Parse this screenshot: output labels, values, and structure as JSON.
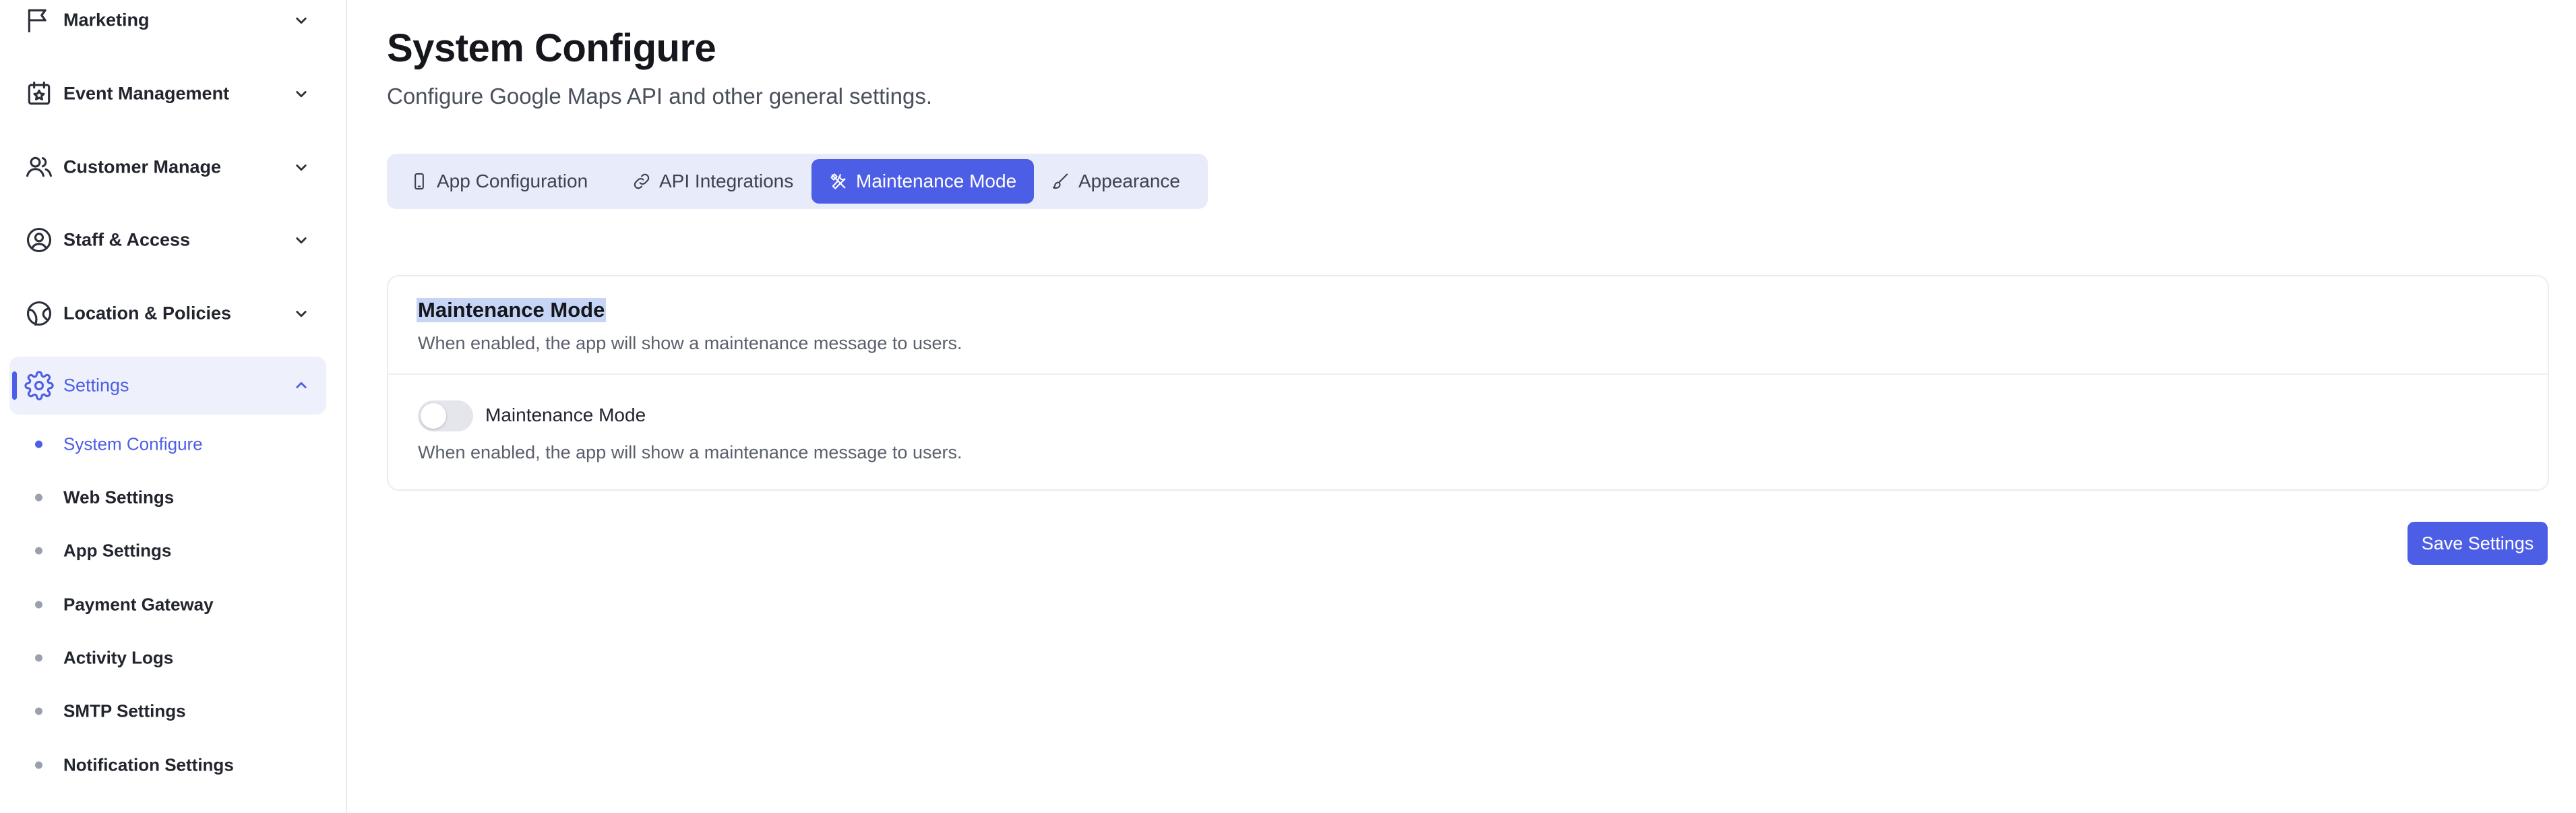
{
  "sidebar": {
    "nav": [
      {
        "label": "Marketing",
        "icon": "megaphone-icon"
      },
      {
        "label": "Event Management",
        "icon": "calendar-star-icon"
      },
      {
        "label": "Customer Manage",
        "icon": "users-icon"
      },
      {
        "label": "Staff & Access",
        "icon": "user-circle-icon"
      },
      {
        "label": "Location & Policies",
        "icon": "globe-icon"
      },
      {
        "label": "Settings",
        "icon": "gear-icon",
        "expanded": true
      }
    ],
    "settings_children": [
      {
        "label": "System Configure",
        "active": true
      },
      {
        "label": "Web Settings"
      },
      {
        "label": "App Settings"
      },
      {
        "label": "Payment Gateway"
      },
      {
        "label": "Activity Logs"
      },
      {
        "label": "SMTP Settings"
      },
      {
        "label": "Notification Settings"
      }
    ]
  },
  "header": {
    "title": "System Configure",
    "subtitle": "Configure Google Maps API and other general settings."
  },
  "tabs": [
    {
      "label": "App Configuration",
      "icon": "smartphone-icon"
    },
    {
      "label": "API Integrations",
      "icon": "link-icon"
    },
    {
      "label": "Maintenance Mode",
      "icon": "tools-icon",
      "active": true
    },
    {
      "label": "Appearance",
      "icon": "brush-icon"
    }
  ],
  "card": {
    "title": "Maintenance Mode",
    "description": "When enabled, the app will show a maintenance message to users.",
    "toggle_label": "Maintenance Mode",
    "toggle_description": "When enabled, the app will show a maintenance message to users.",
    "toggle_on": false
  },
  "actions": {
    "save_label": "Save Settings"
  },
  "colors": {
    "accent": "#4d5ee6",
    "tab_track": "#e7ebfa",
    "active_nav_bg": "#eef1fb"
  }
}
